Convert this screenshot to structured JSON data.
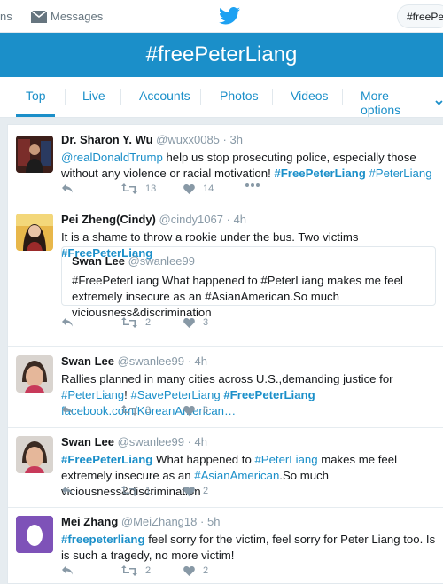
{
  "topbar": {
    "left_partial": "ns",
    "messages": "Messages",
    "search_value": "#freePeterLiang"
  },
  "banner": {
    "title": "#freePeterLiang"
  },
  "tabs": {
    "top": "Top",
    "live": "Live",
    "accounts": "Accounts",
    "photos": "Photos",
    "videos": "Videos",
    "more": "More options"
  },
  "colors": {
    "accent": "#1b8fc9",
    "banner": "#1b8fc9",
    "page_bg": "#e6ecf0"
  },
  "tweets": [
    {
      "name": "Dr. Sharon Y. Wu",
      "handle": "@wuxx0085",
      "time": "3h",
      "mention": "@realDonaldTrump",
      "text": " help us stop prosecuting police, especially those without any violence or racial motivation! ",
      "tag1": "#FreePeterLiang",
      "tag2": "#PeterLiang",
      "retweets": "13",
      "likes": "14"
    },
    {
      "name": "Pei Zheng(Cindy)",
      "handle": "@cindy1067",
      "time": "4h",
      "text": "It is a shame to throw a rookie under the bus. Two victims ",
      "tag1": "#FreePeterLiang",
      "quote": {
        "name": "Swan Lee",
        "handle": "@swanlee99",
        "text": "#FreePeterLiang What happened to #PeterLiang makes me feel extremely insecure as an #AsianAmerican.So much viciousness&discrimination"
      },
      "retweets": "2",
      "likes": "3"
    },
    {
      "name": "Swan Lee",
      "handle": "@swanlee99",
      "time": "4h",
      "text": "Rallies planned in many cities across U.S.,demanding justice for ",
      "tag1": "#PeterLiang",
      "text2": "!",
      "tag2": "#SavePeterLiang",
      "tag3": "#FreePeterLiang",
      "link": "facebook.com/KoreanAmerican…",
      "retweets": "3",
      "likes": "6"
    },
    {
      "name": "Swan Lee",
      "handle": "@swanlee99",
      "time": "4h",
      "tag1": "#FreePeterLiang",
      "text": " What happened to ",
      "tag2": "#PeterLiang",
      "text2": " makes me feel extremely insecure as an ",
      "tag3": "#AsianAmerican",
      "text3": ".So much viciousness&discrimination",
      "retweets": "1",
      "likes": "2"
    },
    {
      "name": "Mei Zhang",
      "handle": "@MeiZhang18",
      "time": "5h",
      "tag1": "#freepeterliang",
      "text": " feel sorry for the victim, feel sorry for Peter Liang too. Is is such a tragedy, no more victim!",
      "retweets": "2",
      "likes": "2"
    }
  ]
}
